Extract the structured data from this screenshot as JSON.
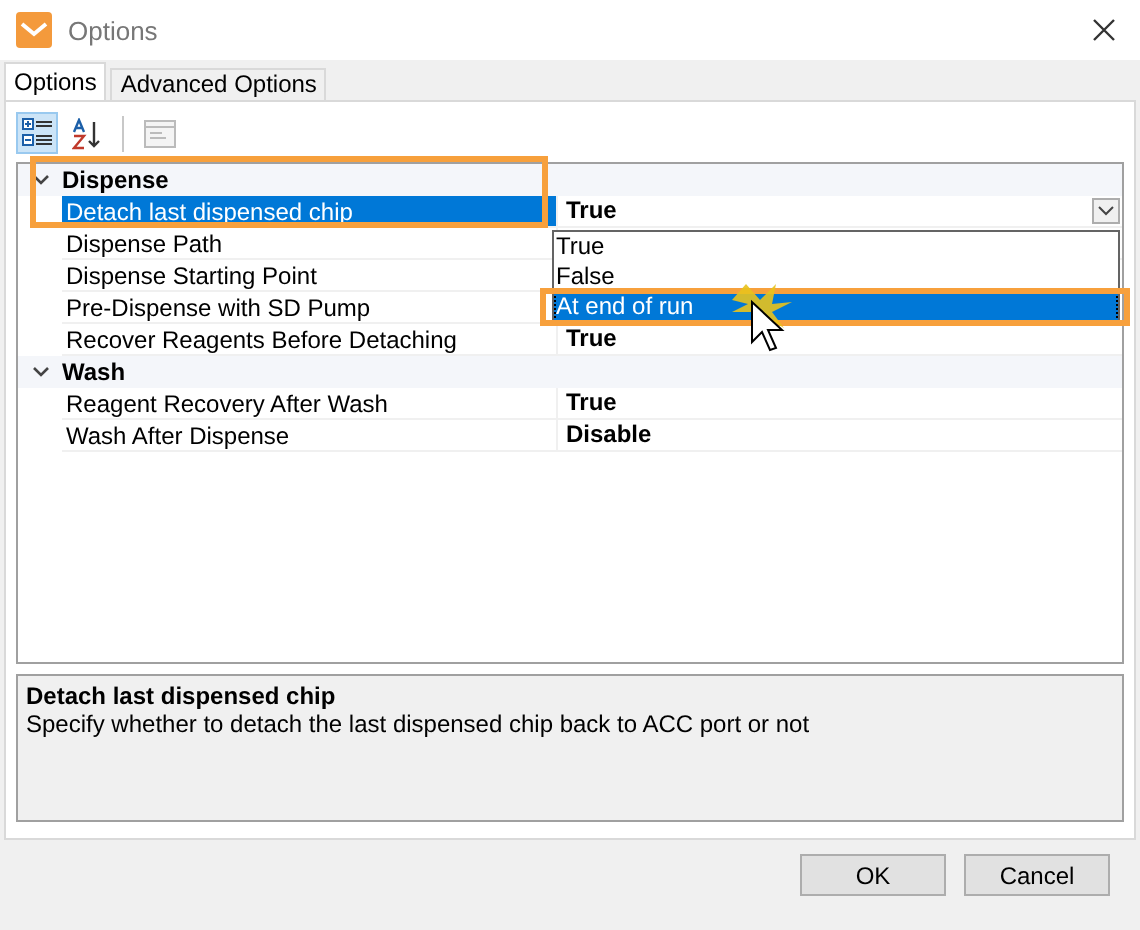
{
  "window": {
    "title": "Options"
  },
  "tabs": [
    {
      "label": "Options",
      "selected": true
    },
    {
      "label": "Advanced Options",
      "selected": false
    }
  ],
  "toolbar": [
    {
      "kind": "categorized",
      "selected": true,
      "disabled": false
    },
    {
      "kind": "alphabetical",
      "selected": false,
      "disabled": false
    },
    {
      "kind": "pages",
      "selected": false,
      "disabled": true
    }
  ],
  "grid": {
    "categories": [
      {
        "name": "Dispense",
        "expanded": true,
        "properties": [
          {
            "name": "Detach last dispensed chip",
            "value": "True",
            "selected": true
          },
          {
            "name": "Dispense Path",
            "selected": false
          },
          {
            "name": "Dispense Starting Point",
            "selected": false
          },
          {
            "name": "Pre-Dispense with SD Pump",
            "selected": false
          },
          {
            "name": "Recover Reagents Before Detaching",
            "value": "True",
            "selected": false
          }
        ]
      },
      {
        "name": "Wash",
        "expanded": true,
        "properties": [
          {
            "name": "Reagent Recovery After Wash",
            "value": "True",
            "selected": false
          },
          {
            "name": "Wash After Dispense",
            "value": "Disable",
            "selected": false
          }
        ]
      }
    ],
    "dropdown": {
      "options": [
        {
          "label": "True",
          "selected": false
        },
        {
          "label": "False",
          "selected": false
        },
        {
          "label": "At end of run",
          "selected": true
        }
      ]
    }
  },
  "description": {
    "title": "Detach last dispensed chip",
    "text": "Specify whether to detach the last dispensed chip back to ACC port or not"
  },
  "buttons": [
    "OK",
    "Cancel"
  ]
}
